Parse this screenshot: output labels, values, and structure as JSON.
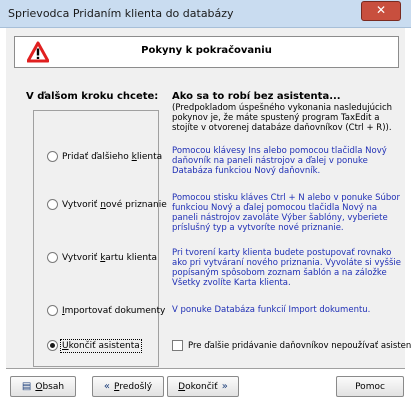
{
  "window": {
    "title": "Sprievodca Pridaním klienta do databázy",
    "close_label": "✕"
  },
  "banner": {
    "title": "Pokyny k pokračovaniu"
  },
  "left": {
    "heading": "V ďalšom kroku chcete:"
  },
  "right": {
    "heading": "Ako sa to robí bez asistenta...",
    "intro": "(Predpokladom úspešného vykonania nasledujúcich pokynov je, že máte spustený program TaxEdit a stojíte v otvorenej databáze daňovníkov (Ctrl + R))."
  },
  "options": [
    {
      "prefix": "Pridať ďalšieho ",
      "accel": "k",
      "suffix": "lienta",
      "checked": false,
      "desc": "Pomocou klávesy Ins alebo pomocou tlačidla Nový daňovník na paneli nástrojov a ďalej v ponuke Databáza funkciou Nový daňovník."
    },
    {
      "prefix": "Vytvoriť ",
      "accel": "n",
      "suffix": "ové priznanie",
      "checked": false,
      "desc": "Pomocou stisku kláves Ctrl + N alebo v ponuke Súbor funkciou Nový a ďalej pomocou tlačidla Nový na paneli nástrojov zavoláte Výber šablóny, vyberiete príslušný typ a vytvoríte nové priznanie."
    },
    {
      "prefix": "Vytvoriť ",
      "accel": "k",
      "suffix": "artu klienta",
      "checked": false,
      "desc": "Pri tvorení karty klienta budete postupovať rovnako ako pri vytváraní nového priznania. Vyvoláte si vyššie popísaným spôsobom zoznam šablón a na záložke Všetky zvolíte Karta klienta."
    },
    {
      "prefix": "",
      "accel": "I",
      "suffix": "mportovať dokumenty",
      "checked": false,
      "desc": "V ponuke Databáza funkcií Import dokumentu."
    },
    {
      "prefix": "",
      "accel": "U",
      "suffix": "končiť asistenta",
      "checked": true,
      "desc": ""
    }
  ],
  "checkbox": {
    "label": "Pre ďalšie pridávanie daňovníkov nepoužívať asistenta.",
    "checked": false
  },
  "buttons": {
    "contents": {
      "accel": "O",
      "rest": "bsah"
    },
    "prev": {
      "accel": "P",
      "rest": "redošlý"
    },
    "finish": {
      "accel": "D",
      "rest": "okončiť"
    },
    "help": {
      "label": "Pomoc"
    }
  },
  "colors": {
    "accent_blue": "#1f2fb5",
    "warning_red": "#e02020",
    "close_red": "#c84f3e"
  }
}
